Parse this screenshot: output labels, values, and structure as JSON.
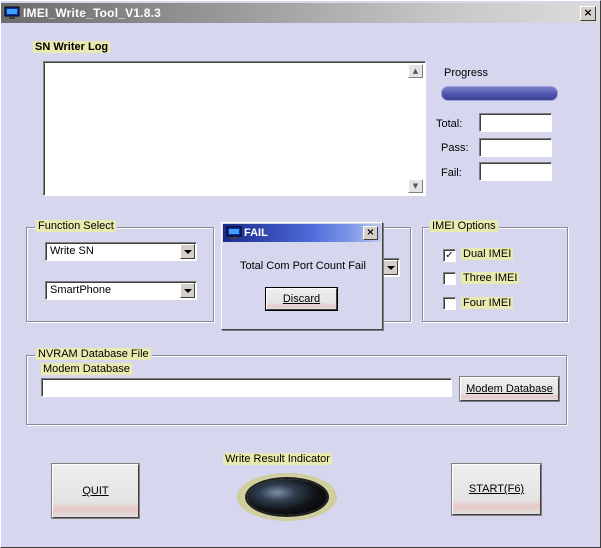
{
  "window": {
    "title": "IMEI_Write_Tool_V1.8.3",
    "close_label": "×"
  },
  "log": {
    "label": "SN Writer Log",
    "scroll_up": "▲",
    "scroll_down": "▼"
  },
  "progress": {
    "label": "Progress",
    "value": 1.0,
    "total_label": "Total:",
    "pass_label": "Pass:",
    "fail_label": "Fail:",
    "total_value": "",
    "pass_value": "",
    "fail_value": ""
  },
  "function_select": {
    "label": "Function Select",
    "function_value": "Write SN",
    "device_value": "SmartPhone"
  },
  "imei_options": {
    "label": "IMEI Options",
    "items": [
      {
        "label": "Dual IMEI",
        "checked": true,
        "mark": "✓"
      },
      {
        "label": "Three IMEI",
        "checked": false,
        "mark": ""
      },
      {
        "label": "Four IMEI",
        "checked": false,
        "mark": ""
      }
    ]
  },
  "nvram": {
    "label": "NVRAM Database File",
    "modem_label": "Modem Database",
    "modem_path": "",
    "modem_button": "Modem Database"
  },
  "dialog": {
    "title": "FAIL",
    "message": "Total Com Port Count Fail",
    "button": "Discard",
    "close_label": "×"
  },
  "indicator": {
    "label": "Write Result Indicator"
  },
  "buttons": {
    "quit": "QUIT",
    "start": "START(F6)"
  }
}
